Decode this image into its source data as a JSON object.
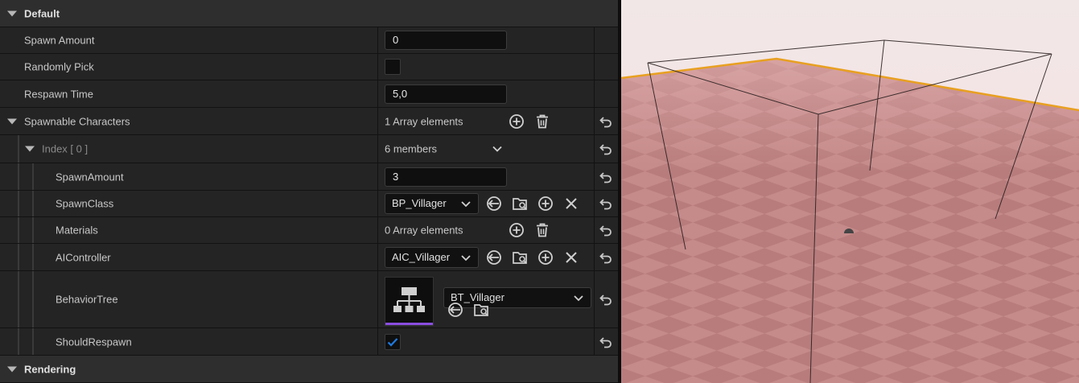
{
  "details": {
    "category_default": "Default",
    "spawn_amount_label": "Spawn Amount",
    "spawn_amount_value": "0",
    "randomly_pick_label": "Randomly Pick",
    "respawn_time_label": "Respawn Time",
    "respawn_time_value": "5,0",
    "spawnable_characters_label": "Spawnable Characters",
    "spawnable_characters_count": "1 Array elements",
    "index_label": "Index [ 0 ]",
    "index_members": "6 members",
    "spawnamount_label": "SpawnAmount",
    "spawnamount_value": "3",
    "spawnclass_label": "SpawnClass",
    "spawnclass_value": "BP_Villager",
    "materials_label": "Materials",
    "materials_count": "0 Array elements",
    "aicontroller_label": "AIController",
    "aicontroller_value": "AIC_Villager",
    "behaviortree_label": "BehaviorTree",
    "behaviortree_value": "BT_Villager",
    "shouldrespawn_label": "ShouldRespawn",
    "category_rendering": "Rendering"
  },
  "state": {
    "randomly_pick_checked": false,
    "should_respawn_checked": true
  },
  "colors": {
    "accent_blue": "#1f7adf",
    "thumbnail_underline": "#8a4de0",
    "floor_tile_a": "#c58a8a",
    "floor_tile_b": "#b87c7c",
    "floor_edge": "#e8a020",
    "sky": "#f3dede"
  },
  "icons": [
    "add-icon",
    "delete-icon",
    "reset-arrow-icon",
    "chevron-down-icon",
    "use-selected-icon",
    "browse-icon",
    "clear-icon",
    "behavior-tree-thumbnail-icon",
    "checkmark-icon",
    "expand-triangle-icon"
  ]
}
